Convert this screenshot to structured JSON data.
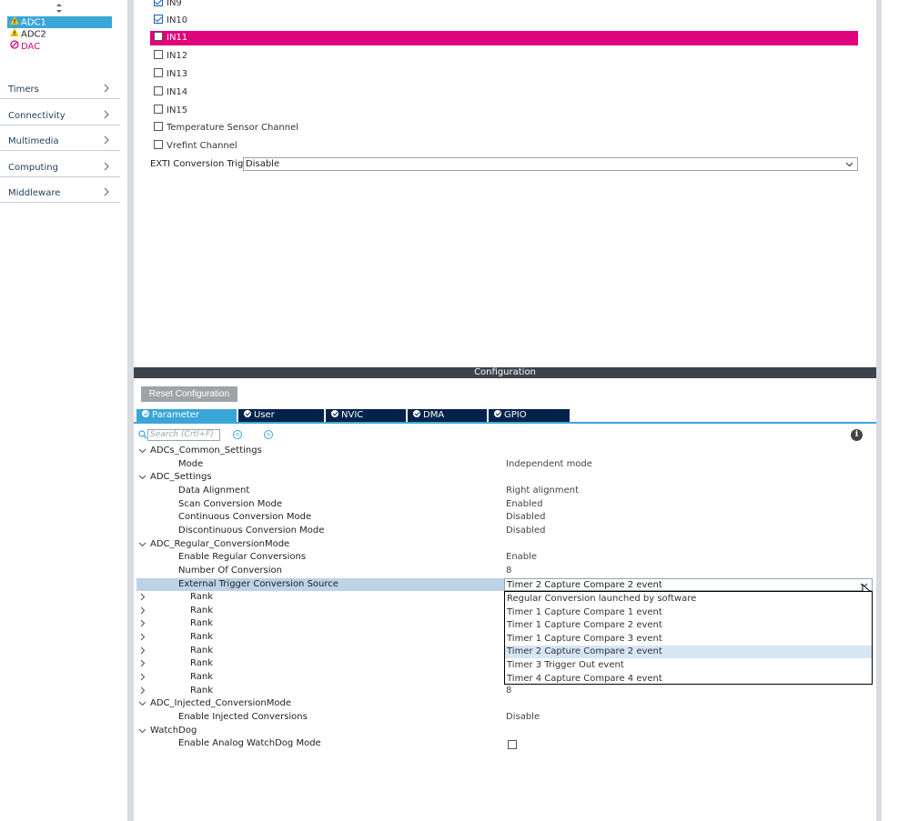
{
  "left_panel": {
    "peripherals": [
      {
        "label": "ADC1",
        "icon": "warning-icon",
        "selected": true
      },
      {
        "label": "ADC2",
        "icon": "warning-icon",
        "selected": false
      },
      {
        "label": "DAC",
        "icon": "disabled-icon",
        "selected": false
      }
    ],
    "categories": [
      "Timers",
      "Connectivity",
      "Multimedia",
      "Computing",
      "Middleware"
    ]
  },
  "channels": [
    {
      "label": "IN9",
      "checked": true
    },
    {
      "label": "IN10",
      "checked": true
    },
    {
      "label": "IN11",
      "checked": false,
      "highlighted": true
    },
    {
      "label": "IN12",
      "checked": false
    },
    {
      "label": "IN13",
      "checked": false
    },
    {
      "label": "IN14",
      "checked": false
    },
    {
      "label": "IN15",
      "checked": false
    },
    {
      "label": "Temperature Sensor Channel",
      "checked": false
    },
    {
      "label": "Vrefint Channel",
      "checked": false
    }
  ],
  "exti": {
    "label": "EXTI Conversion Trigger",
    "value": "Disable"
  },
  "config": {
    "title": "Configuration",
    "reset_label": "Reset Configuration",
    "tabs": [
      "Parameter Settings",
      "User Constants",
      "NVIC Settings",
      "DMA Settings",
      "GPIO Settings"
    ],
    "search_placeholder": "Search (Crtl+F)"
  },
  "params": [
    {
      "type": "group",
      "name": "ADCs_Common_Settings"
    },
    {
      "type": "item",
      "name": "Mode",
      "value": "Independent mode"
    },
    {
      "type": "group",
      "name": "ADC_Settings"
    },
    {
      "type": "item",
      "name": "Data Alignment",
      "value": "Right alignment"
    },
    {
      "type": "item",
      "name": "Scan Conversion Mode",
      "value": "Enabled"
    },
    {
      "type": "item",
      "name": "Continuous Conversion Mode",
      "value": "Disabled"
    },
    {
      "type": "item",
      "name": "Discontinuous Conversion Mode",
      "value": "Disabled"
    },
    {
      "type": "group",
      "name": "ADC_Regular_ConversionMode"
    },
    {
      "type": "item",
      "name": "Enable Regular Conversions",
      "value": "Enable"
    },
    {
      "type": "item",
      "name": "Number Of Conversion",
      "value": "8"
    },
    {
      "type": "item",
      "name": "External Trigger Conversion Source",
      "value": "",
      "highlighted": true
    },
    {
      "type": "rank",
      "name": "Rank",
      "value": ""
    },
    {
      "type": "rank",
      "name": "Rank",
      "value": ""
    },
    {
      "type": "rank",
      "name": "Rank",
      "value": ""
    },
    {
      "type": "rank",
      "name": "Rank",
      "value": ""
    },
    {
      "type": "rank",
      "name": "Rank",
      "value": ""
    },
    {
      "type": "rank",
      "name": "Rank",
      "value": ""
    },
    {
      "type": "rank",
      "name": "Rank",
      "value": ""
    },
    {
      "type": "rank",
      "name": "Rank",
      "value": "8"
    },
    {
      "type": "group",
      "name": "ADC_Injected_ConversionMode"
    },
    {
      "type": "item",
      "name": "Enable Injected Conversions",
      "value": "Disable"
    },
    {
      "type": "group",
      "name": "WatchDog"
    },
    {
      "type": "item",
      "name": "Enable Analog WatchDog Mode",
      "value": "",
      "checkbox": true
    }
  ],
  "dropdown": {
    "value": "Timer 2 Capture Compare 2 event",
    "options": [
      "Regular Conversion launched by software",
      "Timer 1 Capture Compare 1 event",
      "Timer 1 Capture Compare 2 event",
      "Timer 1 Capture Compare 3 event",
      "Timer 2 Capture Compare 2 event",
      "Timer 3 Trigger Out event",
      "Timer 4 Capture Compare 4 event"
    ],
    "selected_index": 4
  },
  "colors": {
    "accent": "#3aa6d8",
    "highlight": "#e0047a",
    "tab_bg": "#03234b",
    "header_bar": "#3d434a"
  }
}
